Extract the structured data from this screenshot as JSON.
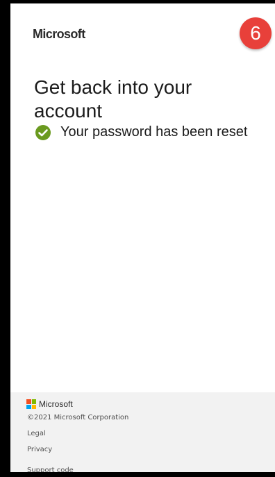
{
  "header": {
    "brand": "Microsoft",
    "step_number": "6",
    "step_badge_color": "#e8403a"
  },
  "main": {
    "title": "Get back into your account",
    "status": {
      "icon": "check-circle-icon",
      "icon_color": "#6a9a1f",
      "text": "Your password has been reset"
    }
  },
  "footer": {
    "brand": "Microsoft",
    "logo_colors": [
      "#f25022",
      "#7fba00",
      "#00a4ef",
      "#ffb900"
    ],
    "copyright": "©2021 Microsoft Corporation",
    "legal": "Legal",
    "privacy": "Privacy",
    "support_code": "Support code"
  }
}
